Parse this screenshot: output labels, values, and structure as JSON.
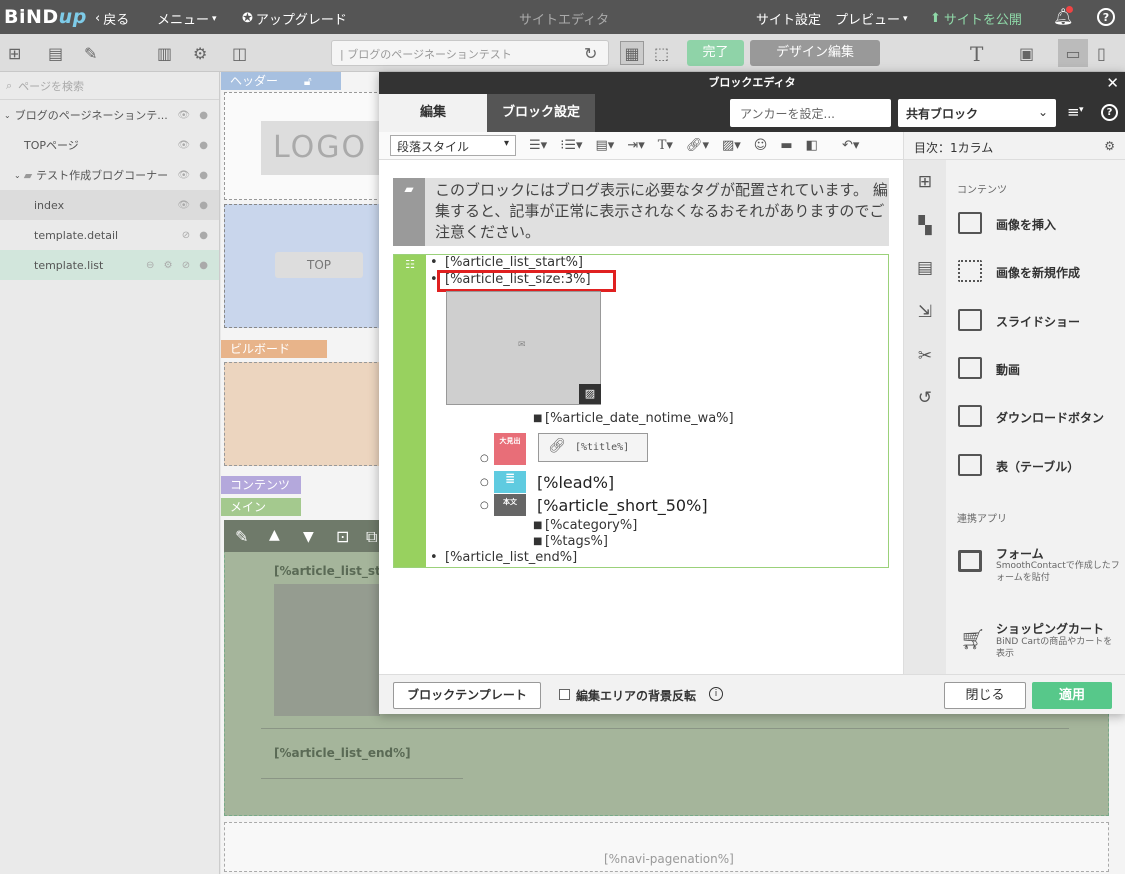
{
  "topbar": {
    "logo": "BiND",
    "logo_up": "up",
    "back": "戻る",
    "menu": "メニュー",
    "upgrade": "アップグレード",
    "center_title": "サイトエディタ",
    "site_settings": "サイト設定",
    "preview": "プレビュー",
    "publish": "サイトを公開"
  },
  "toolbar2": {
    "page_url": "| ブログのページネーションテスト",
    "done": "完了",
    "design_edit": "デザイン編集"
  },
  "sidebar": {
    "search_placeholder": "ページを検索",
    "items": [
      {
        "label": "ブログのページネーションテ..."
      },
      {
        "label": "TOPページ"
      },
      {
        "label": "テスト作成ブログコーナー"
      },
      {
        "label": "index"
      },
      {
        "label": "template.detail"
      },
      {
        "label": "template.list"
      }
    ]
  },
  "canvas": {
    "header_label": "ヘッダー",
    "logo_text": "LOGO",
    "top_button": "TOP",
    "billboard_label": "ビルボード",
    "contents_label": "コンテンツ",
    "main_label": "メイン",
    "list_start": "[%article_list_star",
    "list_end": "[%article_list_end%]",
    "pagination": "[%navi-pagenation%]"
  },
  "modal": {
    "title": "ブロックエディタ",
    "tab_edit": "編集",
    "tab_block_settings": "ブロック設定",
    "anchor_placeholder": "アンカーを設定...",
    "shared_block": "共有ブロック",
    "paragraph_style": "段落スタイル",
    "notice": "このブロックにはブログ表示に必要なタグが配置されています。 編集すると、記事が正常に表示されなくなるおそれがありますのでご注意ください。",
    "list": {
      "start": "[%article_list_start%]",
      "size": "[%article_list_size:3%]",
      "date": "[%article_date_notime_wa%]",
      "title_tag": "大見出",
      "title": "[%title%]",
      "lead": "[%lead%]",
      "body_tag": "本文",
      "short": "[%article_short_50%]",
      "category": "[%category%]",
      "tags": "[%tags%]",
      "end": "[%article_list_end%]"
    },
    "right_panel": {
      "heading": "目次：1カラム",
      "contents_cat": "コンテンツ",
      "items": [
        {
          "label": "画像を挿入"
        },
        {
          "label": "画像を新規作成"
        },
        {
          "label": "スライドショー"
        },
        {
          "label": "動画"
        },
        {
          "label": "ダウンロードボタン"
        },
        {
          "label": "表（テーブル）"
        }
      ],
      "apps_cat": "連携アプリ",
      "form": "フォーム",
      "form_desc": "SmoothContactで作成したフォームを貼付",
      "cart": "ショッピングカート",
      "cart_desc": "BiND Cartの商品やカートを表示"
    },
    "footer": {
      "template": "ブロックテンプレート",
      "invert_bg": "編集エリアの背景反転",
      "close": "閉じる",
      "apply": "適用"
    }
  },
  "colors": {
    "accent_green": "#57c88a",
    "list_green": "#98d15f",
    "highlight_red": "#e02020"
  }
}
